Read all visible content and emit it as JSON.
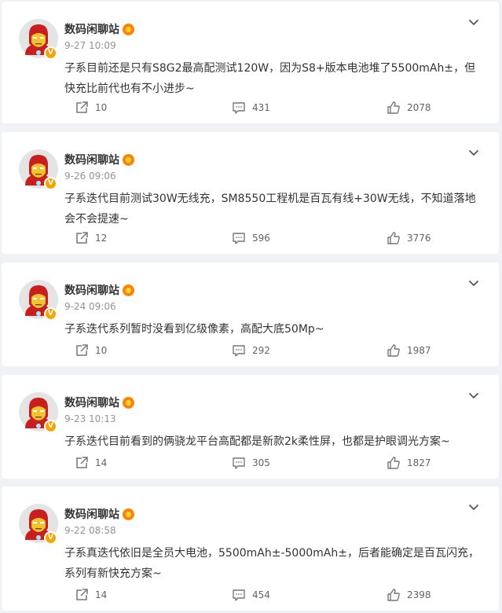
{
  "colors": {
    "background": "#f1f2f5",
    "card": "#ffffff",
    "text": "#333333",
    "meta": "#939393",
    "verified_badge": "#f7a400",
    "medal": "#ff8200"
  },
  "posts": [
    {
      "author": "数码闲聊站",
      "time": "9-27 10:09",
      "text": "子系目前还是只有S8G2最高配测试120W，因为S8+版本电池堆了5500mAh±，但快充比前代也有不小进步~",
      "reposts": "10",
      "comments": "431",
      "likes": "2078"
    },
    {
      "author": "数码闲聊站",
      "time": "9-26 09:06",
      "text": "子系迭代目前测试30W无线充，SM8550工程机是百瓦有线+30W无线，不知道落地会不会提速~",
      "reposts": "12",
      "comments": "596",
      "likes": "3776"
    },
    {
      "author": "数码闲聊站",
      "time": "9-24 09:06",
      "text": "子系迭代系列暂时没看到亿级像素，高配大底50Mp~",
      "reposts": "10",
      "comments": "292",
      "likes": "1987"
    },
    {
      "author": "数码闲聊站",
      "time": "9-23 10:13",
      "text": "子系迭代目前看到的俩骁龙平台高配都是新款2k柔性屏，也都是护眼调光方案~",
      "reposts": "14",
      "comments": "305",
      "likes": "1827"
    },
    {
      "author": "数码闲聊站",
      "time": "9-22 08:58",
      "text": "子系真迭代依旧是全员大电池，5500mAh±-5000mAh±，后者能确定是百瓦闪充，系列有新快充方案~",
      "reposts": "14",
      "comments": "454",
      "likes": "2398"
    }
  ]
}
